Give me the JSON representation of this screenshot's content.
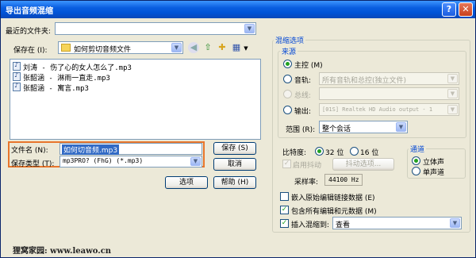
{
  "window": {
    "title": "导出音频混缩",
    "help_btn": "?",
    "close_btn": "✕"
  },
  "recent": {
    "label": "最近的文件夹:",
    "value": ""
  },
  "savein": {
    "label": "保存在 (I):",
    "value": "如何剪切音频文件"
  },
  "files": [
    "刘涛 - 伤了心的女人怎么了.mp3",
    "张韶涵 - 淋雨一直走.mp3",
    "张韶涵 - 寓言.mp3"
  ],
  "filename": {
    "label": "文件名 (N):",
    "value": "如何切音频.mp3"
  },
  "filetype": {
    "label": "保存类型 (T):",
    "value": "mp3PRO? (FhG) (*.mp3)"
  },
  "buttons": {
    "save": "保存 (S)",
    "cancel": "取消",
    "options": "选项",
    "help": "帮助 (H)"
  },
  "mix": {
    "group_title": "混缩选项",
    "source_title": "来源",
    "master": "主控 (M)",
    "track": "音轨:",
    "track_value": "所有音轨和总控(独立文件)",
    "bus": "总线:",
    "bus_value": "",
    "output": "输出:",
    "output_value": "[01S] Realtek HD Audio output - 1",
    "range_label": "范围 (R):",
    "range_value": "整个会话"
  },
  "bitdepth": {
    "label": "比特度:",
    "opt32": "32 位",
    "opt16": "16 位",
    "dither": "启用抖动",
    "dither_btn": "抖动选项...",
    "samplerate_label": "采样率:",
    "samplerate_value": "44100 Hz"
  },
  "channel": {
    "title": "通道",
    "stereo": "立体声",
    "mono": "单声道"
  },
  "options": {
    "embed": "嵌入原始编辑链接数据 (E)",
    "include_meta": "包含所有编辑和元数据 (M)",
    "insert_label": "插入混缩到:",
    "insert_value": "查看"
  },
  "watermark": "狸窝家园: www.leawo.cn"
}
